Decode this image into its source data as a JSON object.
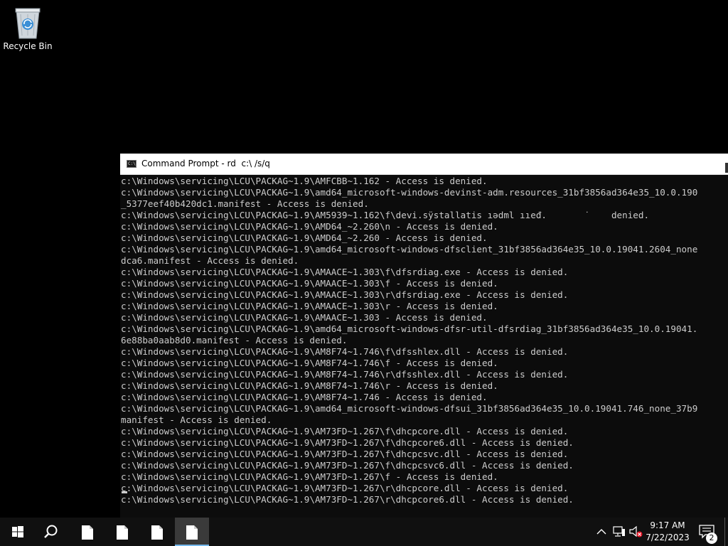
{
  "desktop": {
    "icons": [
      {
        "label": "Recycle Bin",
        "icon": "recycle-bin-icon"
      }
    ]
  },
  "cmd": {
    "title": "Command Prompt - rd  c:\\ /s/q",
    "icon": "cmd-window-icon",
    "colors": {
      "background": "#0c0c0c",
      "text": "#cccccc"
    },
    "lines": [
      "c:\\Windows\\servicing\\LCU\\PACKAG~1.9\\AMFCBB~1.162 - Access is denied.",
      "c:\\Windows\\servicing\\LCU\\PACKAG~1.9\\amd64_microsoft-windows-devinst-adm.resources_31bf3856ad364e35_10.0.190",
      "_5377eef40b420dc1.manifest - Access is denied.",
      "c:\\Windows\\servicing\\LCU\\PACKAG~1.9\\AM5939~1.162\\f\\devi.sÿstallatis ıədml ııeđ.       ˙    denied.",
      "c:\\Windows\\servicing\\LCU\\PACKAG~1.9\\AMD64_~2.260\\n - Access is denied.",
      "c:\\Windows\\servicing\\LCU\\PACKAG~1.9\\AMD64_~2.260 - Access is denied.",
      "c:\\Windows\\servicing\\LCU\\PACKAG~1.9\\amd64_microsoft-windows-dfsclient_31bf3856ad364e35_10.0.19041.2604_none",
      "dca6.manifest - Access is denied.",
      "c:\\Windows\\servicing\\LCU\\PACKAG~1.9\\AMAACE~1.303\\f\\dfsrdiag.exe - Access is denied.",
      "c:\\Windows\\servicing\\LCU\\PACKAG~1.9\\AMAACE~1.303\\f - Access is denied.",
      "c:\\Windows\\servicing\\LCU\\PACKAG~1.9\\AMAACE~1.303\\r\\dfsrdiag.exe - Access is denied.",
      "c:\\Windows\\servicing\\LCU\\PACKAG~1.9\\AMAACE~1.303\\r - Access is denied.",
      "c:\\Windows\\servicing\\LCU\\PACKAG~1.9\\AMAACE~1.303 - Access is denied.",
      "c:\\Windows\\servicing\\LCU\\PACKAG~1.9\\amd64_microsoft-windows-dfsr-util-dfsrdiag_31bf3856ad364e35_10.0.19041.",
      "6e88ba0aab8d0.manifest - Access is denied.",
      "c:\\Windows\\servicing\\LCU\\PACKAG~1.9\\AM8F74~1.746\\f\\dfsshlex.dll - Access is denied.",
      "c:\\Windows\\servicing\\LCU\\PACKAG~1.9\\AM8F74~1.746\\f - Access is denied.",
      "c:\\Windows\\servicing\\LCU\\PACKAG~1.9\\AM8F74~1.746\\r\\dfsshlex.dll - Access is denied.",
      "c:\\Windows\\servicing\\LCU\\PACKAG~1.9\\AM8F74~1.746\\r - Access is denied.",
      "c:\\Windows\\servicing\\LCU\\PACKAG~1.9\\AM8F74~1.746 - Access is denied.",
      "c:\\Windows\\servicing\\LCU\\PACKAG~1.9\\amd64_microsoft-windows-dfsui_31bf3856ad364e35_10.0.19041.746_none_37b9",
      "manifest - Access is denied.",
      "c:\\Windows\\servicing\\LCU\\PACKAG~1.9\\AM73FD~1.267\\f\\dhcpcore.dll - Access is denied.",
      "c:\\Windows\\servicing\\LCU\\PACKAG~1.9\\AM73FD~1.267\\f\\dhcpcore6.dll - Access is denied.",
      "c:\\Windows\\servicing\\LCU\\PACKAG~1.9\\AM73FD~1.267\\f\\dhcpcsvc.dll - Access is denied.",
      "c:\\Windows\\servicing\\LCU\\PACKAG~1.9\\AM73FD~1.267\\f\\dhcpcsvc6.dll - Access is denied.",
      "c:\\Windows\\servicing\\LCU\\PACKAG~1.9\\AM73FD~1.267\\f - Access is denied.",
      "c:\\Windows\\servicing\\LCU\\PACKAG~1.9\\AM73FD~1.267\\r\\dhcpcore.dll - Access is denied.",
      "c:\\Windows\\servicing\\LCU\\PACKAG~1.9\\AM73FD~1.267\\r\\dhcpcore6.dll - Access is denied."
    ]
  },
  "taskbar": {
    "buttons": [
      {
        "icon": "windows-start-icon"
      },
      {
        "icon": "search-icon"
      },
      {
        "icon": "document-icon"
      },
      {
        "icon": "document-icon"
      },
      {
        "icon": "document-icon"
      },
      {
        "icon": "document-icon",
        "active": true
      }
    ],
    "tray": {
      "icons": [
        "chevron-up-icon",
        "network-icon",
        "volume-muted-icon"
      ],
      "time": "9:17 AM",
      "date": "7/22/2023",
      "notification_icon": "notification-icon",
      "notification_count": "2"
    },
    "accent": "#76b9ed"
  }
}
